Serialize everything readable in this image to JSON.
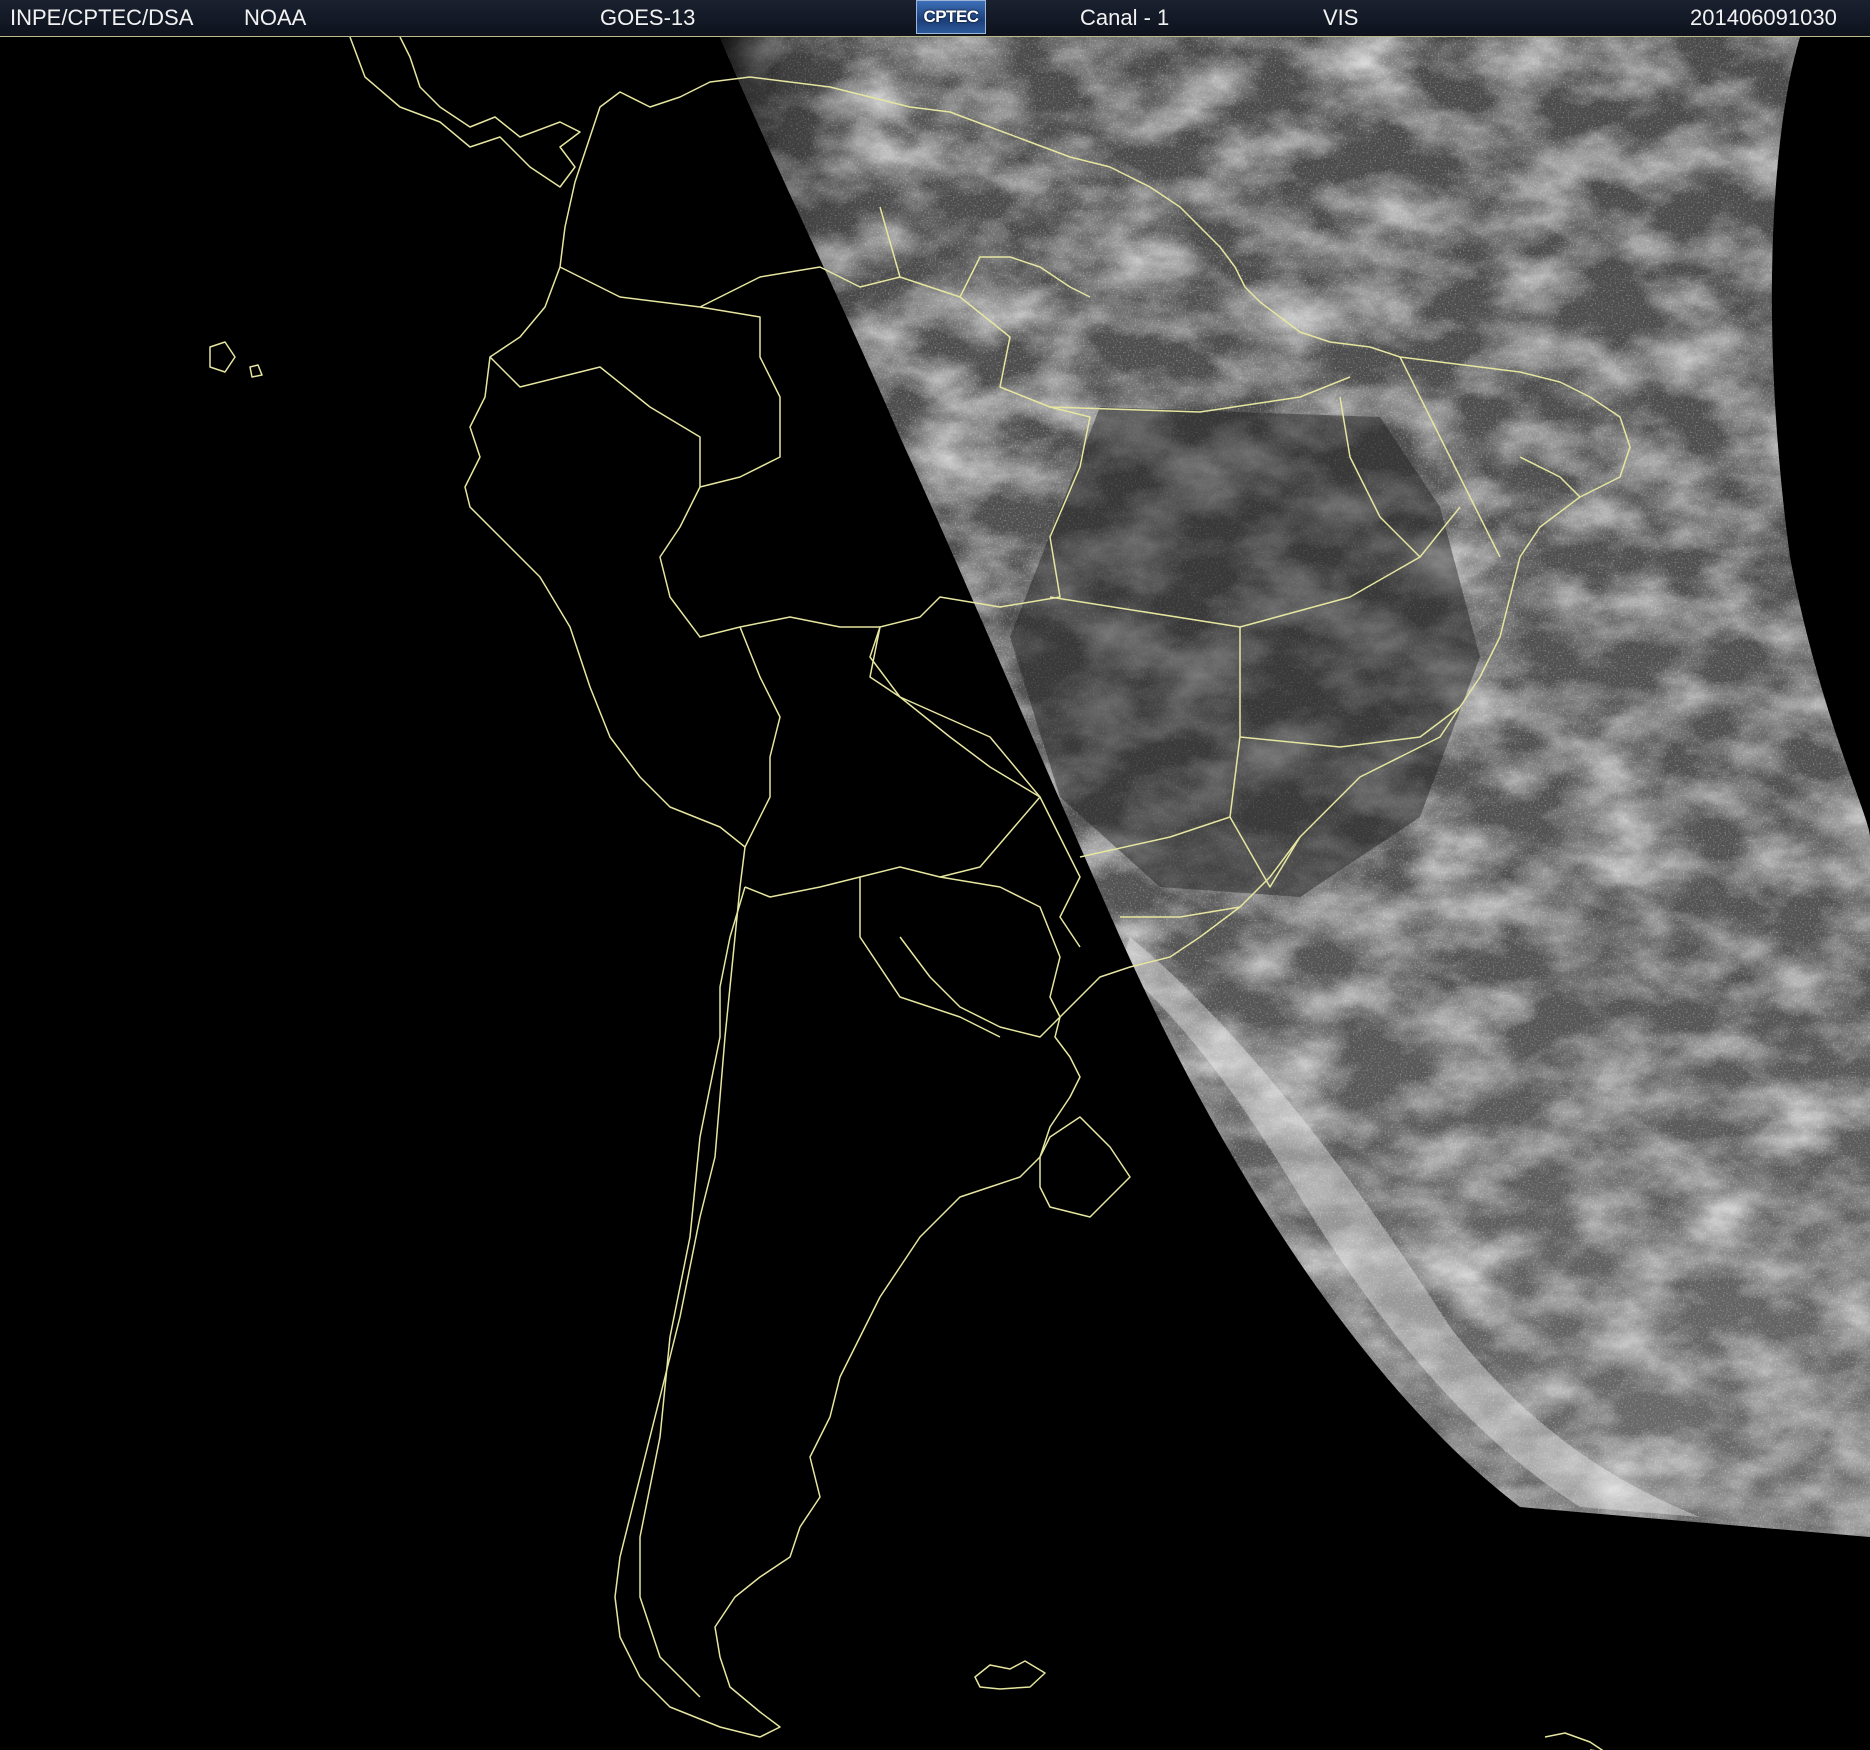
{
  "header": {
    "source": "INPE/CPTEC/DSA",
    "agency": "NOAA",
    "satellite": "GOES-13",
    "logo_text": "CPTEC",
    "channel": "Canal - 1",
    "band": "VIS",
    "timestamp": "201406091030"
  },
  "colors": {
    "background": "#000000",
    "header_bg": "#131a26",
    "border_lines": "#e6e6a0",
    "cloud_gray": "#5a5a5a"
  },
  "map": {
    "region": "South America",
    "image_type": "visible satellite image",
    "illuminated_side": "east"
  }
}
